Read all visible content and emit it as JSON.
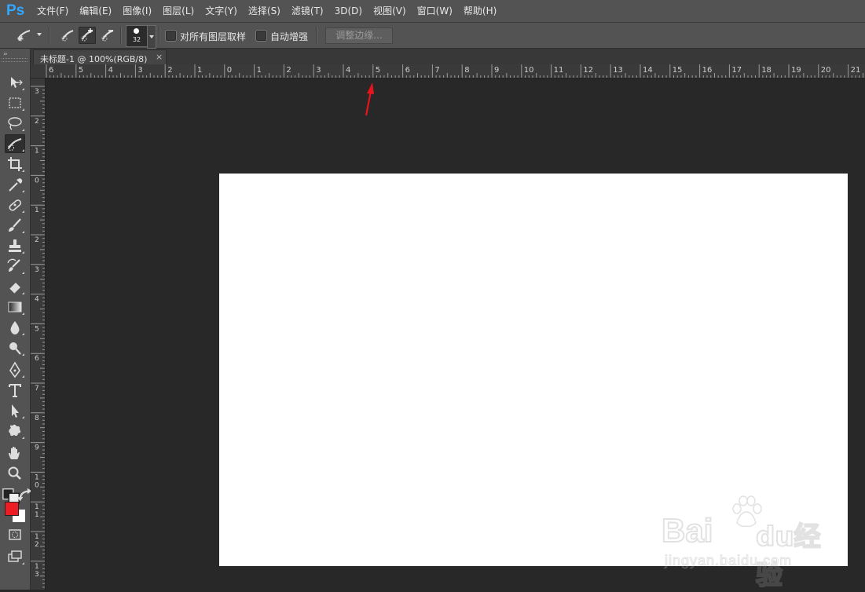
{
  "app": {
    "logo": "Ps"
  },
  "menu": [
    {
      "label": "文件(F)",
      "name": "menu-file"
    },
    {
      "label": "编辑(E)",
      "name": "menu-edit"
    },
    {
      "label": "图像(I)",
      "name": "menu-image"
    },
    {
      "label": "图层(L)",
      "name": "menu-layer"
    },
    {
      "label": "文字(Y)",
      "name": "menu-type"
    },
    {
      "label": "选择(S)",
      "name": "menu-select"
    },
    {
      "label": "滤镜(T)",
      "name": "menu-filter"
    },
    {
      "label": "3D(D)",
      "name": "menu-3d"
    },
    {
      "label": "视图(V)",
      "name": "menu-view"
    },
    {
      "label": "窗口(W)",
      "name": "menu-window"
    },
    {
      "label": "帮助(H)",
      "name": "menu-help"
    }
  ],
  "options": {
    "brush_size": "32",
    "sample_all_layers": "对所有图层取样",
    "auto_enhance": "自动增强",
    "refine_edge": "调整边缘..."
  },
  "toolbar": {
    "collapse": "››",
    "tools": [
      "move-tool-icon",
      "marquee-tool-icon",
      "lasso-tool-icon",
      "quick-selection-tool-icon",
      "crop-tool-icon",
      "eyedropper-tool-icon",
      "healing-brush-tool-icon",
      "brush-tool-icon",
      "clone-stamp-tool-icon",
      "history-brush-tool-icon",
      "eraser-tool-icon",
      "gradient-tool-icon",
      "blur-tool-icon",
      "dodge-tool-icon",
      "pen-tool-icon",
      "type-tool-icon",
      "path-selection-tool-icon",
      "custom-shape-tool-icon",
      "hand-tool-icon",
      "zoom-tool-icon"
    ],
    "active_tool": "quick-selection-tool-icon",
    "foreground_color": "#ee1c24",
    "background_color": "#ffffff"
  },
  "document": {
    "tab_title": "未标题-1 @ 100%(RGB/8)",
    "tab_close": "×",
    "canvas_color": "#ffffff"
  },
  "rulers": {
    "top_labels": [
      "6",
      "5",
      "4",
      "3",
      "2",
      "1",
      "0",
      "1",
      "2",
      "3",
      "4",
      "5",
      "6",
      "7",
      "8",
      "9",
      "10",
      "11",
      "12",
      "13",
      "14",
      "15",
      "16",
      "17",
      "18",
      "19",
      "20",
      "21"
    ],
    "left_labels": [
      "3",
      "2",
      "1",
      "0",
      "1",
      "2",
      "3",
      "4",
      "5",
      "6",
      "7",
      "8",
      "9",
      "10",
      "11",
      "12",
      "13"
    ]
  },
  "annotation": {
    "arrow_color": "#e8141c"
  },
  "watermark": {
    "brand": "Bai",
    "brand_cn": "du经验",
    "url": "jingyan.baidu.com"
  }
}
